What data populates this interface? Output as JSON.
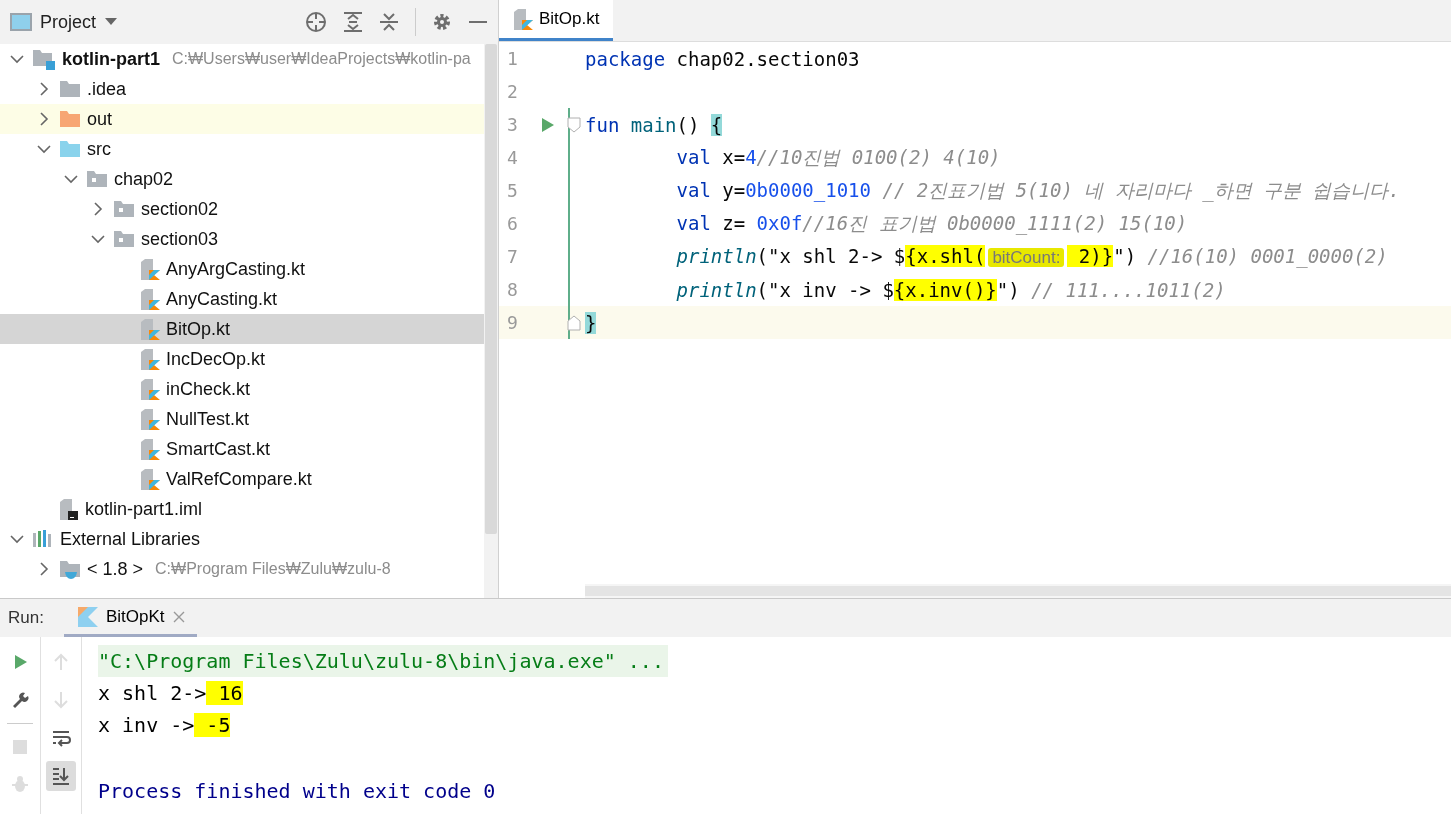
{
  "project_panel": {
    "title": "Project",
    "tree": [
      {
        "kind": "module",
        "label": "kotlin-part1",
        "path": "C:₩Users₩user₩IdeaProjects₩kotlin-pa",
        "expanded": true,
        "selected": false,
        "highlighted": false,
        "children": [
          {
            "kind": "folder",
            "label": ".idea",
            "expanded": false,
            "selected": false,
            "highlighted": false
          },
          {
            "kind": "folder-excluded",
            "label": "out",
            "expanded": false,
            "selected": false,
            "highlighted": true
          },
          {
            "kind": "folder-source",
            "label": "src",
            "expanded": true,
            "selected": false,
            "highlighted": false,
            "children": [
              {
                "kind": "package",
                "label": "chap02",
                "expanded": true,
                "selected": false,
                "highlighted": false,
                "children": [
                  {
                    "kind": "package",
                    "label": "section02",
                    "expanded": false,
                    "selected": false,
                    "highlighted": false
                  },
                  {
                    "kind": "package",
                    "label": "section03",
                    "expanded": true,
                    "selected": false,
                    "highlighted": false,
                    "children": [
                      {
                        "kind": "kotlin-file",
                        "label": "AnyArgCasting.kt",
                        "selected": false,
                        "highlighted": false
                      },
                      {
                        "kind": "kotlin-file",
                        "label": "AnyCasting.kt",
                        "selected": false,
                        "highlighted": false
                      },
                      {
                        "kind": "kotlin-file",
                        "label": "BitOp.kt",
                        "selected": true,
                        "highlighted": false
                      },
                      {
                        "kind": "kotlin-file",
                        "label": "IncDecOp.kt",
                        "selected": false,
                        "highlighted": false
                      },
                      {
                        "kind": "kotlin-file",
                        "label": "inCheck.kt",
                        "selected": false,
                        "highlighted": false
                      },
                      {
                        "kind": "kotlin-file",
                        "label": "NullTest.kt",
                        "selected": false,
                        "highlighted": false
                      },
                      {
                        "kind": "kotlin-file",
                        "label": "SmartCast.kt",
                        "selected": false,
                        "highlighted": false
                      },
                      {
                        "kind": "kotlin-file",
                        "label": "ValRefCompare.kt",
                        "selected": false,
                        "highlighted": false
                      }
                    ]
                  }
                ]
              }
            ]
          },
          {
            "kind": "iml-file",
            "label": "kotlin-part1.iml",
            "selected": false,
            "highlighted": false
          }
        ]
      },
      {
        "kind": "libraries",
        "label": "External Libraries",
        "expanded": true,
        "selected": false,
        "highlighted": false,
        "children": [
          {
            "kind": "jdk",
            "label": "< 1.8 >",
            "path": "C:₩Program Files₩Zulu₩zulu-8",
            "expanded": false,
            "selected": false,
            "highlighted": false
          }
        ]
      }
    ]
  },
  "editor": {
    "tabs": [
      {
        "label": "BitOp.kt",
        "selected": true
      }
    ],
    "lines": [
      {
        "number": "1",
        "current": false,
        "scope": false,
        "indented": false,
        "tokens": [
          {
            "kind": "keyword",
            "text": "package"
          },
          {
            "kind": "plain",
            "text": " chap02.section03"
          }
        ]
      },
      {
        "number": "2",
        "current": false,
        "scope": false
      },
      {
        "number": "3",
        "current": false,
        "scope": true,
        "indented": false,
        "run_marker": true,
        "fold_start": true,
        "tokens": [
          {
            "kind": "keyword",
            "text": "fun"
          },
          {
            "kind": "function",
            "text": " main"
          },
          {
            "kind": "plain",
            "text": "() "
          },
          {
            "kind": "brace",
            "text": "{"
          }
        ]
      },
      {
        "number": "4",
        "current": false,
        "scope": true,
        "indented": true,
        "tokens": [
          {
            "kind": "keyword",
            "text": "val"
          },
          {
            "kind": "plain",
            "text": " x="
          },
          {
            "kind": "number",
            "text": "4"
          },
          {
            "kind": "comment",
            "text": "//10진법 0100(2) 4(10)"
          }
        ]
      },
      {
        "number": "5",
        "current": false,
        "scope": true,
        "indented": true,
        "tokens": [
          {
            "kind": "keyword",
            "text": "val"
          },
          {
            "kind": "plain",
            "text": " y="
          },
          {
            "kind": "number",
            "text": "0b0000_1010"
          },
          {
            "kind": "comment",
            "text": " // 2진표기법 5(10) 네 자리마다 _하면 구분 쉽습니다."
          }
        ]
      },
      {
        "number": "6",
        "current": false,
        "scope": true,
        "indented": true,
        "tokens": [
          {
            "kind": "keyword",
            "text": "val"
          },
          {
            "kind": "plain",
            "text": " z= "
          },
          {
            "kind": "number",
            "text": "0x0f"
          },
          {
            "kind": "comment",
            "text": "//16진 표기법 0b0000_1111(2) 15(10)"
          }
        ]
      },
      {
        "number": "7",
        "current": false,
        "scope": true,
        "indented": true,
        "tokens": [
          {
            "kind": "call",
            "text": "println"
          },
          {
            "kind": "plain",
            "text": "(\"x shl 2-> $"
          },
          {
            "kind": "plain",
            "text": "{x.shl(",
            "highlight": true
          },
          {
            "kind": "hint",
            "text": "bitCount:",
            "highlight": true
          },
          {
            "kind": "plain",
            "text": " 2)}",
            "highlight": true
          },
          {
            "kind": "plain",
            "text": "\")"
          },
          {
            "kind": "comment",
            "text": " //16(10) 0001_0000(2)"
          }
        ]
      },
      {
        "number": "8",
        "current": false,
        "scope": true,
        "indented": true,
        "tokens": [
          {
            "kind": "call",
            "text": "println"
          },
          {
            "kind": "plain",
            "text": "(\"x inv -> $"
          },
          {
            "kind": "plain",
            "text": "{x.inv()}",
            "highlight": true
          },
          {
            "kind": "plain",
            "text": "\")"
          },
          {
            "kind": "comment",
            "text": " // 111....1011(2)"
          }
        ]
      },
      {
        "number": "9",
        "current": true,
        "scope": true,
        "indented": false,
        "fold_end": true,
        "tokens": [
          {
            "kind": "brace",
            "text": "}"
          }
        ]
      }
    ]
  },
  "run_panel": {
    "label": "Run:",
    "tabs": [
      {
        "label": "BitOpKt",
        "selected": true
      }
    ],
    "tools_left": [
      {
        "kind": "run",
        "disabled": false
      },
      {
        "kind": "wrench",
        "disabled": false
      },
      {
        "kind": "separator"
      },
      {
        "kind": "stop",
        "disabled": true
      },
      {
        "kind": "debug",
        "disabled": true
      }
    ],
    "tools_right": [
      {
        "kind": "up",
        "disabled": true,
        "selected": false
      },
      {
        "kind": "down",
        "disabled": true,
        "selected": false
      },
      {
        "kind": "wrap",
        "disabled": false,
        "selected": false
      },
      {
        "kind": "scroll-end",
        "disabled": false,
        "selected": true
      }
    ],
    "console": [
      {
        "kind": "command",
        "tokens": [
          {
            "text": "\"C:\\Program Files\\Zulu\\zulu-8\\bin\\java.exe\" ..."
          }
        ]
      },
      {
        "kind": "output",
        "tokens": [
          {
            "text": "x shl 2->"
          },
          {
            "text": " 16",
            "highlight": true
          }
        ]
      },
      {
        "kind": "output",
        "tokens": [
          {
            "text": "x inv ->"
          },
          {
            "text": " -5",
            "highlight": true
          }
        ]
      },
      {
        "kind": "blank"
      },
      {
        "kind": "system",
        "tokens": [
          {
            "text": "Process finished with exit code 0"
          }
        ]
      }
    ]
  }
}
